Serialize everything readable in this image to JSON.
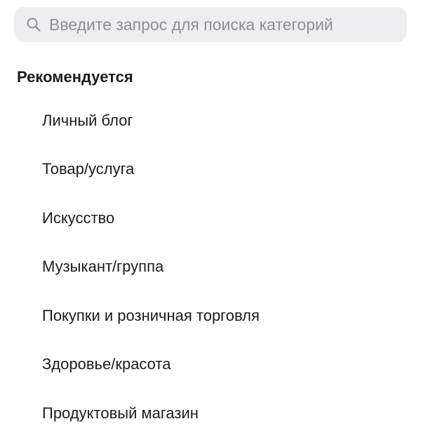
{
  "search": {
    "icon": "search-icon",
    "placeholder": "Введите запрос для поиска категорий",
    "value": ""
  },
  "section": {
    "title": "Рекомендуется"
  },
  "categories": [
    {
      "label": "Личный блог"
    },
    {
      "label": "Товар/услуга"
    },
    {
      "label": "Искусство"
    },
    {
      "label": "Музыкант/группа"
    },
    {
      "label": "Покупки и розничная торговля"
    },
    {
      "label": "Здоровье/красота"
    },
    {
      "label": "Продуктовый магазин"
    }
  ],
  "colors": {
    "search_background": "#eeeef0",
    "placeholder": "#8e8e93",
    "text": "#1c1c1e"
  }
}
